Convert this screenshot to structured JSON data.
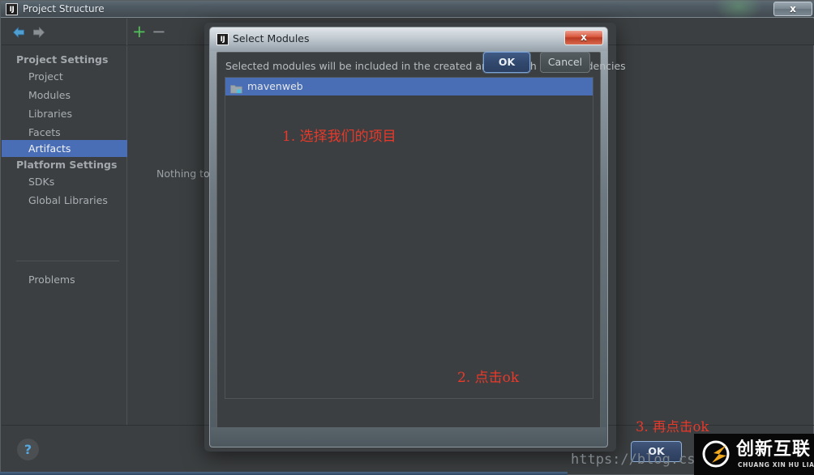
{
  "main_window": {
    "title": "Project Structure",
    "icon_label": "IJ",
    "close_label": "x",
    "toolbar": {
      "back_icon": "back-arrow",
      "forward_icon": "forward-arrow",
      "add_label": "+",
      "remove_label": "−"
    },
    "sidebar": {
      "groups": [
        {
          "label": "Project Settings"
        },
        {
          "label": "Platform Settings"
        }
      ],
      "items": [
        {
          "label": "Project",
          "selected": false
        },
        {
          "label": "Modules",
          "selected": false
        },
        {
          "label": "Libraries",
          "selected": false
        },
        {
          "label": "Facets",
          "selected": false
        },
        {
          "label": "Artifacts",
          "selected": true
        },
        {
          "label": "SDKs",
          "selected": false
        },
        {
          "label": "Global Libraries",
          "selected": false
        },
        {
          "label": "Problems",
          "selected": false
        }
      ]
    },
    "content": {
      "empty_text": "Nothing to"
    },
    "help_label": "?"
  },
  "dialog": {
    "title": "Select Modules",
    "icon_label": "IJ",
    "close_label": "x",
    "hint": "Selected modules will be included in the created artifact with all dependencies",
    "module_list": [
      {
        "label": "mavenweb",
        "icon": "folder-icon",
        "selected": true
      }
    ],
    "ok_label": "OK",
    "cancel_label": "Cancel"
  },
  "annotations": [
    {
      "text": "1. 选择我们的项目",
      "color": "#e8392a"
    },
    {
      "text": "2. 点击ok",
      "color": "#e8392a"
    },
    {
      "text": "3. 再点击ok",
      "color": "#e8392a"
    }
  ],
  "background_ok_button": {
    "label": "OK"
  },
  "watermark": {
    "url": "https://blog.cs",
    "logo_cn": "创新互联",
    "logo_pinyin": "CHUANG XIN HU LIAN"
  },
  "colors": {
    "accent_blue": "#4a6eb5",
    "annotation_red": "#e8392a",
    "panel_bg": "#3c3f41",
    "add_green": "#51c15a"
  }
}
